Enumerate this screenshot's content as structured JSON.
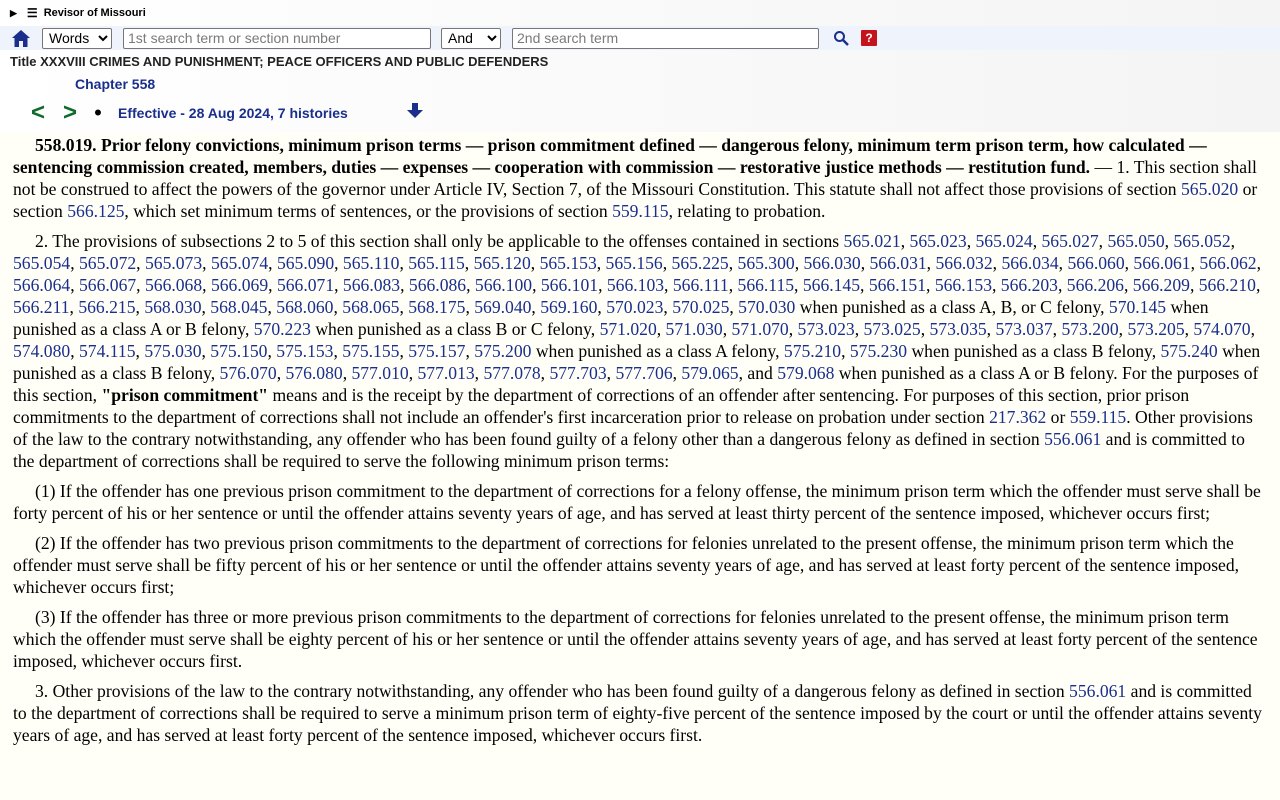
{
  "site": {
    "name": "Revisor of Missouri",
    "menu_icon": "hamburger-icon",
    "expand_icon": "triangle-right-icon"
  },
  "search": {
    "mode_options": [
      "Words"
    ],
    "mode_selected": "Words",
    "term1_placeholder": "1st search term or section number",
    "op_options": [
      "And"
    ],
    "op_selected": "And",
    "term2_placeholder": "2nd search term",
    "help_label": "?"
  },
  "header": {
    "title": "Title XXXVIII CRIMES AND PUNISHMENT; PEACE OFFICERS AND PUBLIC DEFENDERS",
    "chapter": "Chapter 558",
    "prev": "<",
    "next": ">",
    "dot": "•",
    "effective": "Effective - 28 Aug 2024, 7 histories"
  },
  "statute": {
    "heading": "558.019.  Prior felony convictions, minimum prison terms — prison commitment defined — dangerous felony, minimum term prison term, how calculated — sentencing commission created, members, duties — expenses — cooperation with commission — restorative justice methods — restitution fund.",
    "p1_text_a": " — 1.  This section shall not be construed to affect the powers of the governor under Article IV, Section 7, of the Missouri Constitution.  This statute shall not affect those provisions of section ",
    "p1_link1": "565.020",
    "p1_text_b": " or section ",
    "p1_link2": "566.125",
    "p1_text_c": ", which set minimum terms of sentences, or the provisions of section ",
    "p1_link3": "559.115",
    "p1_text_d": ", relating to probation.",
    "p2_intro": "2.  The provisions of subsections 2 to 5 of this section shall only be applicable to the offenses contained in sections ",
    "p2_links_a": [
      "565.021",
      "565.023",
      "565.024",
      "565.027",
      "565.050",
      "565.052",
      "565.054",
      "565.072",
      "565.073",
      "565.074",
      "565.090",
      "565.110",
      "565.115",
      "565.120",
      "565.153",
      "565.156",
      "565.225",
      "565.300",
      "566.030",
      "566.031",
      "566.032",
      "566.034",
      "566.060",
      "566.061",
      "566.062",
      "566.064",
      "566.067",
      "566.068",
      "566.069",
      "566.071",
      "566.083",
      "566.086",
      "566.100",
      "566.101",
      "566.103",
      "566.111",
      "566.115",
      "566.145",
      "566.151",
      "566.153",
      "566.203",
      "566.206",
      "566.209",
      "566.210",
      "566.211",
      "566.215",
      "568.030",
      "568.045",
      "568.060",
      "568.065",
      "568.175",
      "569.040",
      "569.160",
      "570.023",
      "570.025",
      "570.030"
    ],
    "p2_text_a": " when punished as a class A, B, or C felony, ",
    "p2_link_b": "570.145",
    "p2_text_b": " when punished as a class A or B felony, ",
    "p2_link_c": "570.223",
    "p2_text_c": " when punished as a class B or C felony, ",
    "p2_links_d": [
      "571.020",
      "571.030",
      "571.070",
      "573.023",
      "573.025",
      "573.035",
      "573.037",
      "573.200",
      "573.205",
      "574.070",
      "574.080",
      "574.115",
      "575.030",
      "575.150",
      "575.153",
      "575.155",
      "575.157",
      "575.200"
    ],
    "p2_text_d": " when punished as a class A felony, ",
    "p2_links_e": [
      "575.210",
      "575.230"
    ],
    "p2_text_e": " when punished as a class B felony, ",
    "p2_link_f": "575.240",
    "p2_text_f": " when punished as a class B felony, ",
    "p2_links_g": [
      "576.070",
      "576.080",
      "577.010",
      "577.013",
      "577.078",
      "577.703",
      "577.706",
      "579.065"
    ],
    "p2_text_and": ", and ",
    "p2_link_h": "579.068",
    "p2_text_h": " when punished as a class A or B felony.  For the purposes of this section, ",
    "p2_term": "\"prison commitment\"",
    "p2_text_i": " means and is the receipt by the department of corrections of an offender after sentencing.  For purposes of this section, prior prison commitments to the department of corrections shall not include an offender's first incarceration prior to release on probation under section ",
    "p2_link_j": "217.362",
    "p2_text_j": " or ",
    "p2_link_k": "559.115",
    "p2_text_k": ".  Other provisions of the law to the contrary notwithstanding, any offender who has been found guilty of a felony other than a dangerous felony as defined in section ",
    "p2_link_l": "556.061",
    "p2_text_l": " and is committed to the department of corrections shall be required to serve the following minimum prison terms:",
    "item1": "(1)  If the offender has one previous prison commitment to the department of corrections for a felony offense, the minimum prison term which the offender must serve shall be forty percent of his or her sentence or until the offender attains seventy years of age, and has served at least thirty percent of the sentence imposed, whichever occurs first;",
    "item2": "(2)  If the offender has two previous prison commitments to the department of corrections for felonies unrelated to the present offense, the minimum prison term which the offender must serve shall be fifty percent of his or her sentence or until the offender attains seventy years of age, and has served at least forty percent of the sentence imposed, whichever occurs first;",
    "item3": "(3)  If the offender has three or more previous prison commitments to the department of corrections for felonies unrelated to the present offense, the minimum prison term which the offender must serve shall be eighty percent of his or her sentence or until the offender attains seventy years of age, and has served at least forty percent of the sentence imposed, whichever occurs first.",
    "p3_text_a": "3.  Other provisions of the law to the contrary notwithstanding, any offender who has been found guilty of a dangerous felony as defined in section ",
    "p3_link": "556.061",
    "p3_text_b": " and is committed to the department of corrections shall be required to serve a minimum prison term of eighty-five percent of the sentence imposed by the court or until the offender attains seventy years of age, and has served at least forty percent of the sentence imposed, whichever occurs first."
  }
}
